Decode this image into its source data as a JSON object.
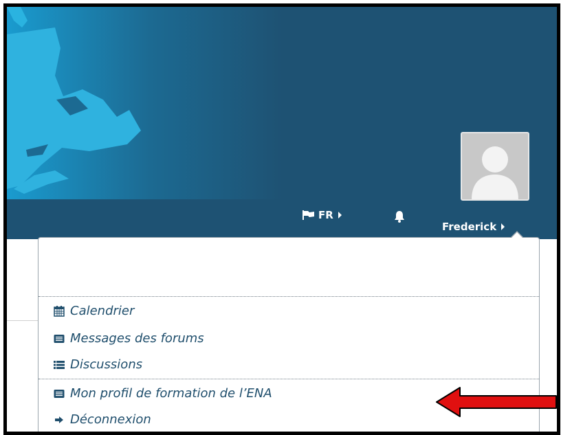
{
  "navbar": {
    "language": "FR",
    "user_name": "Frederick"
  },
  "user_menu": {
    "items": [
      {
        "label": "Calendrier",
        "icon": "calendar-icon"
      },
      {
        "label": "Messages des forums",
        "icon": "list-box-icon"
      },
      {
        "label": "Discussions",
        "icon": "list-icon"
      },
      {
        "label": "Mon profil de formation de l’ENA",
        "icon": "list-box-icon"
      },
      {
        "label": "Déconnexion",
        "icon": "logout-icon"
      }
    ]
  },
  "colors": {
    "header_bg": "#1e5273",
    "banner_accent": "#1ba7d6",
    "menu_text": "#1f4e6c",
    "annotation_arrow": "#e01010"
  }
}
